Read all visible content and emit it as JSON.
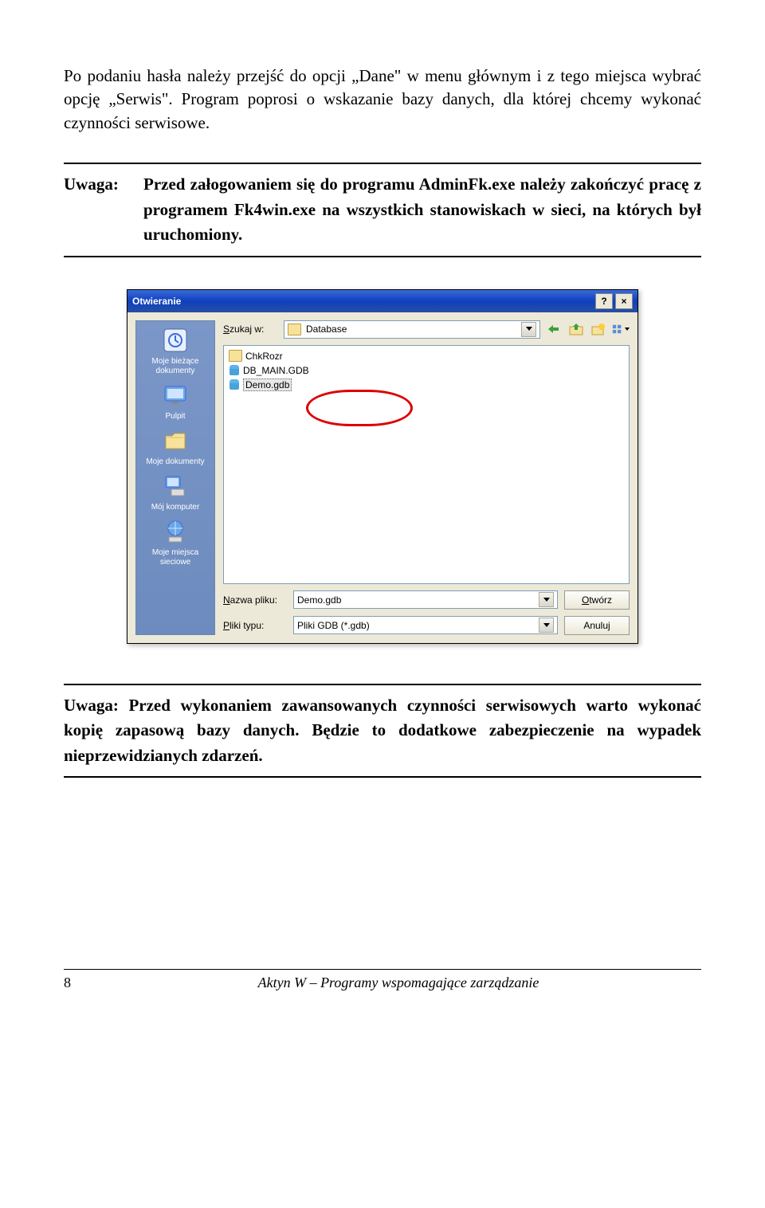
{
  "intro": "Po podaniu hasła należy przejść do opcji „Dane\" w menu głównym i z tego miejsca wybrać opcję „Serwis\". Program poprosi o wskazanie bazy danych, dla której chcemy wykonać czynności serwisowe.",
  "note1_label": "Uwaga:",
  "note1_text": "Przed załogowaniem się do programu AdminFk.exe należy zakończyć pracę z programem Fk4win.exe na wszystkich stanowiskach w sieci, na których był uruchomiony.",
  "note2_text": "Uwaga: Przed wykonaniem zawansowanych czynności serwisowych warto wykonać kopię zapasową bazy danych. Będzie to dodatkowe zabezpieczenie na wypadek nieprzewidzianych zdarzeń.",
  "dialog": {
    "title": "Otwieranie",
    "help": "?",
    "close": "×",
    "lookin_label": "Szukaj w:",
    "lookin_value": "Database",
    "files": {
      "folder1": "ChkRozr",
      "file1": "DB_MAIN.GDB",
      "file2": "Demo.gdb"
    },
    "filename_label": "Nazwa pliku:",
    "filename_value": "Demo.gdb",
    "filetype_label": "Pliki typu:",
    "filetype_value": "Pliki GDB (*.gdb)",
    "open_btn": "Otwórz",
    "cancel_btn": "Anuluj",
    "open_u": "O",
    "places": {
      "recent": "Moje bieżące dokumenty",
      "desktop": "Pulpit",
      "mydocs": "Moje dokumenty",
      "mycomp": "Mój komputer",
      "network": "Moje miejsca sieciowe"
    }
  },
  "footer": {
    "page": "8",
    "text": "Aktyn W – Programy wspomagające zarządzanie"
  }
}
